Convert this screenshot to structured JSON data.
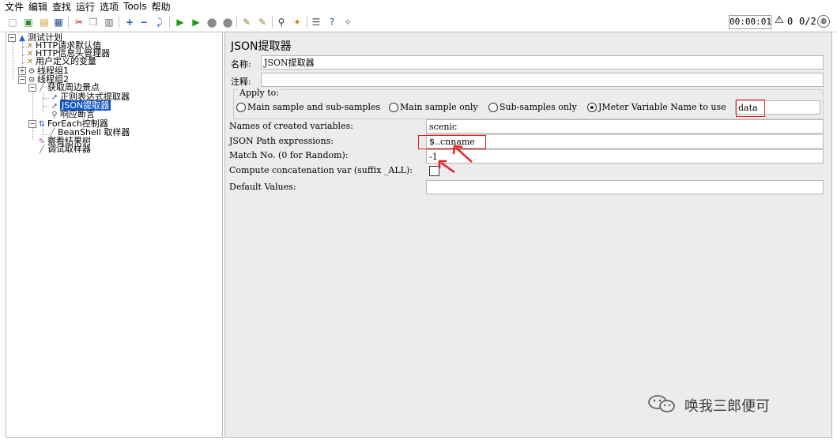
{
  "menubar": {
    "items": [
      "文件",
      "编辑",
      "查找",
      "运行",
      "选项",
      "Tools",
      "帮助"
    ]
  },
  "toolbar": {
    "timer": "00:00:01",
    "warning_count": "0",
    "threads": "0/2",
    "icons": [
      "new-icon",
      "templates-icon",
      "open-icon",
      "save-icon",
      "cut-icon",
      "copy-icon",
      "paste-icon",
      "expand-icon",
      "collapse-icon",
      "toggle-icon",
      "start-icon",
      "start-no-pause-icon",
      "stop-icon",
      "shutdown-icon",
      "clear-icon",
      "clear-all-icon",
      "search-icon",
      "reset-search-icon",
      "function-helper-icon",
      "help-icon",
      "remote-icon"
    ]
  },
  "tree": {
    "nodes": [
      {
        "label": "测试计划",
        "icon": "test-plan-icon"
      },
      {
        "label": "HTTP请求默认值",
        "icon": "config-icon"
      },
      {
        "label": "HTTP信息头管理器",
        "icon": "config-icon"
      },
      {
        "label": "用户定义的变量",
        "icon": "config-icon"
      },
      {
        "label": "线程组1",
        "icon": "thread-group-icon"
      },
      {
        "label": "线程组2",
        "icon": "thread-group-icon"
      },
      {
        "label": "获取周边景点",
        "icon": "sampler-icon"
      },
      {
        "label": "正则表达式提取器",
        "icon": "extractor-icon"
      },
      {
        "label": "JSON提取器",
        "icon": "extractor-icon"
      },
      {
        "label": "响应断言",
        "icon": "assertion-icon"
      },
      {
        "label": "ForEach控制器",
        "icon": "controller-icon"
      },
      {
        "label": "BeanShell 取样器",
        "icon": "sampler-icon"
      },
      {
        "label": "察看结果树",
        "icon": "listener-icon"
      },
      {
        "label": "调试取样器",
        "icon": "sampler-icon"
      }
    ]
  },
  "panel": {
    "title": "JSON提取器",
    "name_label": "名称:",
    "name_value": "JSON提取器",
    "comment_label": "注释:",
    "comment_value": "",
    "apply_to_label": "Apply to:",
    "apply_options": [
      "Main sample and sub-samples",
      "Main sample only",
      "Sub-samples only",
      "JMeter Variable Name to use"
    ],
    "apply_selected": "JMeter Variable Name to use",
    "jmeter_var_value": "data",
    "names_label": "Names of created variables:",
    "names_value": "scenic",
    "json_path_label": "JSON Path expressions:",
    "json_path_value": "$..cnname",
    "match_no_label": "Match No. (0 for Random):",
    "match_no_value": "-1",
    "concat_label": "Compute concatenation var (suffix _ALL):",
    "concat_checked": false,
    "default_label": "Default Values:",
    "default_value": ""
  },
  "watermark": {
    "text": "唤我三郎便可"
  },
  "colors": {
    "selection": "#1057c9",
    "annotation_red": "#e82020",
    "panel_bg": "#ececec"
  }
}
